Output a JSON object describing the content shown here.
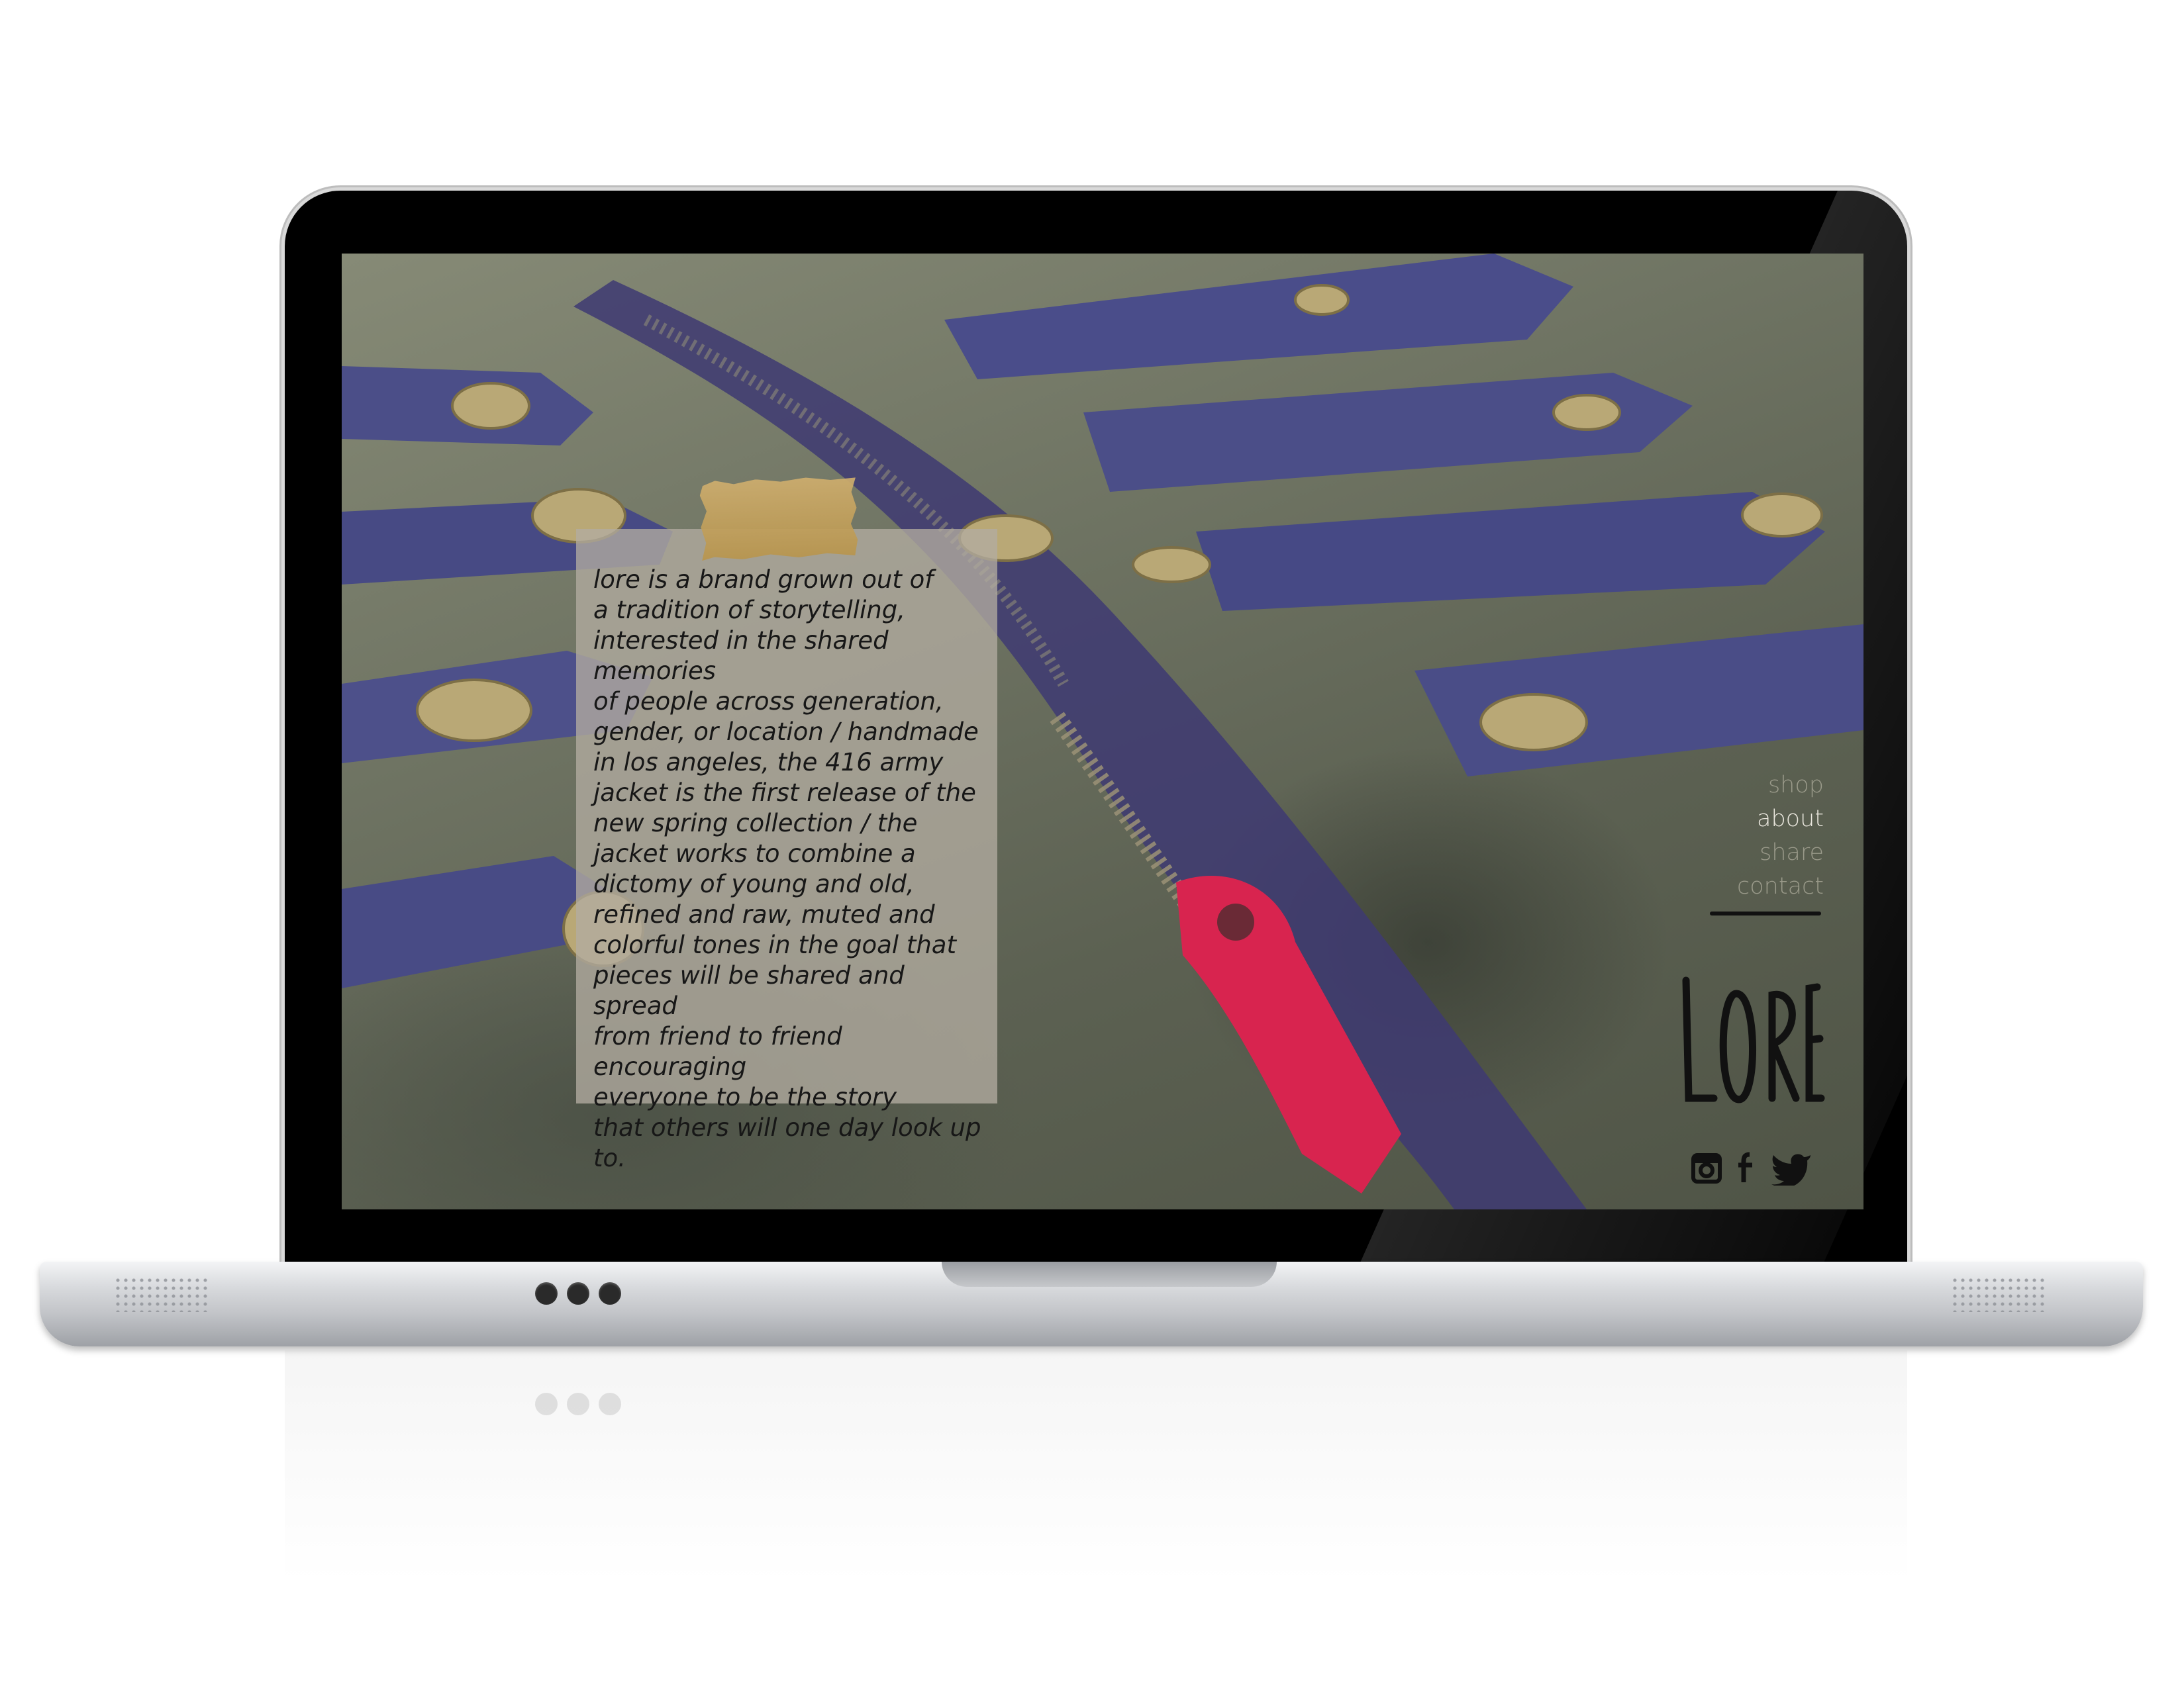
{
  "site": {
    "story_text": "lore is a brand grown out of\na tradition of storytelling,\ninterested in the shared memories\nof people across generation,\ngender, or location / handmade\nin los angeles, the 416 army\njacket is the first release of the\nnew spring collection / the\njacket works to combine a\ndictomy of young and old,\nrefined and raw, muted and\ncolorful tones in the goal that\npieces will be shared and spread\nfrom friend to friend encouraging\neveryone to be the story\nthat others will one day look up to.",
    "nav": [
      {
        "label": "shop"
      },
      {
        "label": "about"
      },
      {
        "label": "share"
      },
      {
        "label": "contact"
      }
    ],
    "logo_text": "LORE",
    "social_icons": [
      "instagram-icon",
      "facebook-icon",
      "twitter-icon"
    ]
  },
  "colors": {
    "card": "#b2aca0",
    "tape": "#c6a45e",
    "zipper_pull": "#d8244f",
    "denim": "#4b4e88",
    "jacket": "#6f7463"
  }
}
